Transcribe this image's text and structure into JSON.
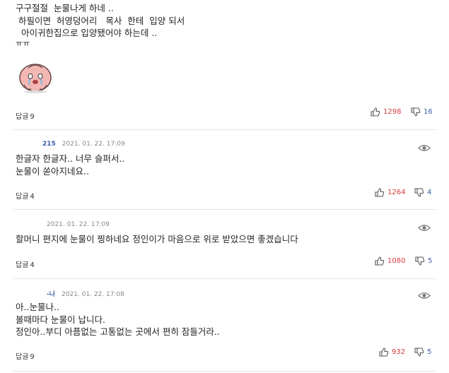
{
  "comments": [
    {
      "nick": "",
      "time": "",
      "lines": [
        "구구절절  눈물나게 하네 ..",
        " 하필이면  허영덩어리   목사  한테  입양 되서",
        "  아이귀한집으로 입양됐어야 하는데 ..",
        "ㅠㅠ"
      ],
      "reply_label": "답글",
      "reply_count": "9",
      "up": "1298",
      "down": "16"
    },
    {
      "nick": "215",
      "time": "2021. 01. 22. 17:09",
      "lines": [
        "한글자 한글자.. 너무 슬퍼서..",
        "눈물이 쏟아지네요.."
      ],
      "reply_label": "답글",
      "reply_count": "4",
      "up": "1264",
      "down": "4"
    },
    {
      "nick": "",
      "time": "2021. 01. 22. 17:09",
      "lines": [
        "할머니 편지에 눈물이 찡하네요 정인이가 마음으로 위로 받았으면 좋겠습니다"
      ],
      "reply_label": "답글",
      "reply_count": "4",
      "up": "1080",
      "down": "5"
    },
    {
      "nick": "-나",
      "time": "2021. 01. 22. 17:08",
      "lines": [
        "아..눈물나..",
        "볼때마다 눈물이 납니다.",
        "정인아..부디 아픔없는 고통없는 곳에서 편히 잠들거라.."
      ],
      "reply_label": "답글",
      "reply_count": "9",
      "up": "932",
      "down": "5"
    }
  ],
  "icons": {
    "sticker": "crying-peach-sticker-icon",
    "thumbs_up": "thumbs-up-icon",
    "thumbs_down": "thumbs-down-icon",
    "eye": "eye-icon"
  }
}
